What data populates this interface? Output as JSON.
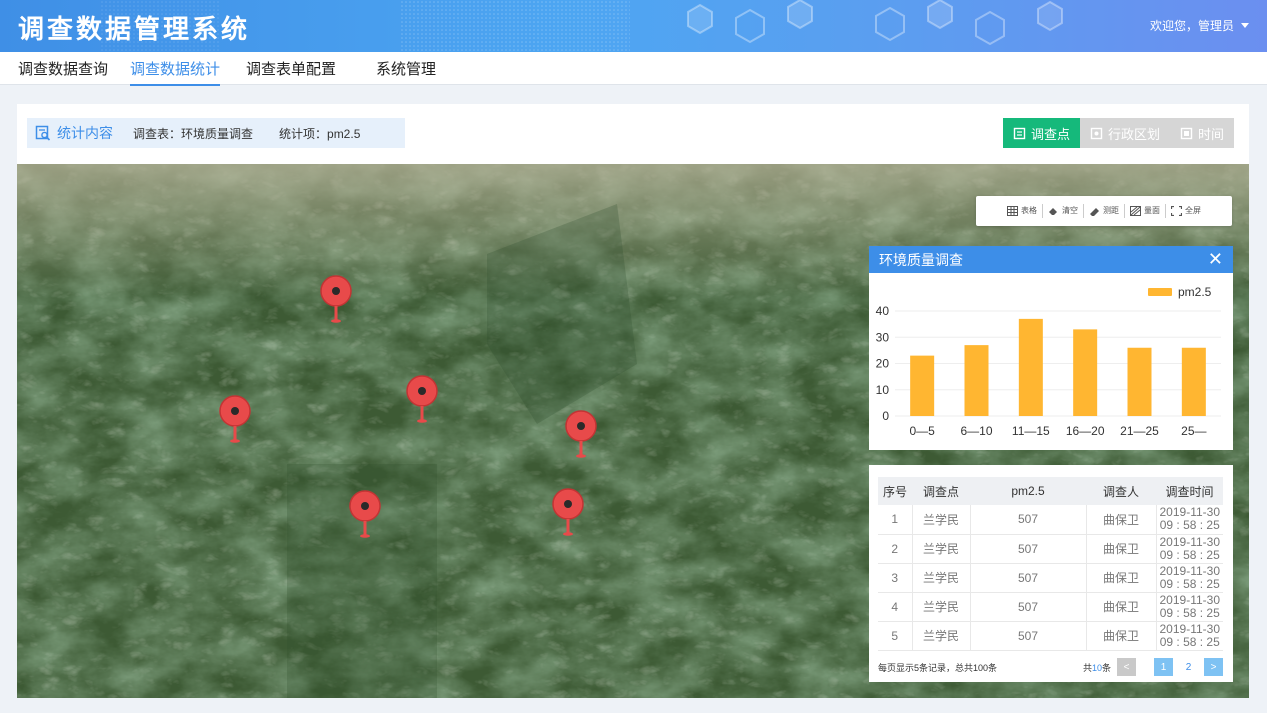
{
  "app": {
    "title": "调查数据管理系统",
    "user_greeting": "欢迎您，管理员"
  },
  "nav": {
    "items": [
      {
        "label": "调查数据查询"
      },
      {
        "label": "调查数据统计"
      },
      {
        "label": "调查表单配置"
      },
      {
        "label": "系统管理"
      }
    ],
    "active_index": 1
  },
  "stat": {
    "title": "统计内容",
    "survey_label": "调查表：环境质量调查",
    "item_label": "统计项：pm2.5"
  },
  "modes": [
    {
      "label": "调查点",
      "active": true
    },
    {
      "label": "行政区划",
      "active": false
    },
    {
      "label": "时间",
      "active": false
    }
  ],
  "tools": [
    {
      "label": "表格",
      "icon": "table-icon"
    },
    {
      "label": "清空",
      "icon": "eraser-icon"
    },
    {
      "label": "测距",
      "icon": "ruler-icon"
    },
    {
      "label": "量面",
      "icon": "area-icon"
    },
    {
      "label": "全屏",
      "icon": "fullscreen-icon"
    }
  ],
  "popup": {
    "title": "环境质量调查"
  },
  "chart_data": {
    "type": "bar",
    "categories": [
      "0—5",
      "6—10",
      "11—15",
      "16—20",
      "21—25",
      "25—"
    ],
    "series": [
      {
        "name": "pm2.5",
        "values": [
          23,
          27,
          37,
          33,
          26,
          26
        ]
      }
    ],
    "yticks": [
      0,
      10,
      20,
      30,
      40
    ],
    "ylim": [
      0,
      40
    ],
    "color": "#ffb631",
    "legend": "top-right",
    "grid": true
  },
  "table": {
    "headers": [
      "序号",
      "调查点",
      "pm2.5",
      "调查人",
      "调查时间"
    ],
    "rows": [
      {
        "idx": "1",
        "point": "兰学民",
        "value": "507",
        "person": "曲保卫",
        "date": "2019-11-30",
        "time": "09 : 58 : 25"
      },
      {
        "idx": "2",
        "point": "兰学民",
        "value": "507",
        "person": "曲保卫",
        "date": "2019-11-30",
        "time": "09 : 58 : 25"
      },
      {
        "idx": "3",
        "point": "兰学民",
        "value": "507",
        "person": "曲保卫",
        "date": "2019-11-30",
        "time": "09 : 58 : 25"
      },
      {
        "idx": "4",
        "point": "兰学民",
        "value": "507",
        "person": "曲保卫",
        "date": "2019-11-30",
        "time": "09 : 58 : 25"
      },
      {
        "idx": "5",
        "point": "兰学民",
        "value": "507",
        "person": "曲保卫",
        "date": "2019-11-30",
        "time": "09 : 58 : 25"
      }
    ]
  },
  "pager": {
    "summary": "每页显示5条记录，总共100条",
    "total_prefix": "共",
    "total_count": "10",
    "total_suffix": "条",
    "pages": [
      "1",
      "2"
    ]
  }
}
